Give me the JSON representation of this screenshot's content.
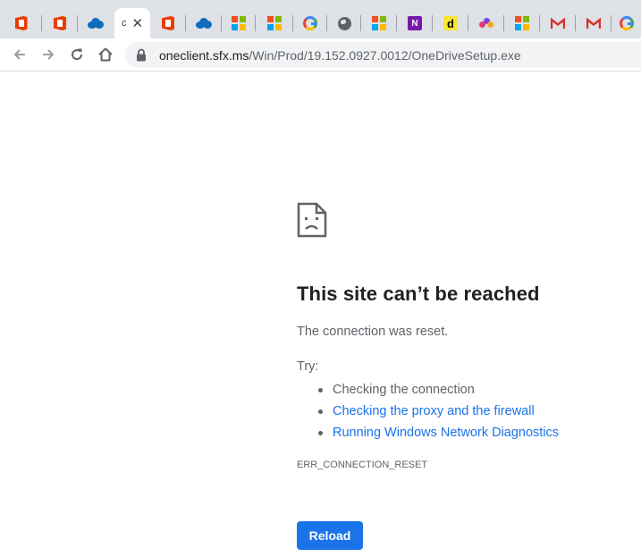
{
  "browser": {
    "tabs": [
      {
        "favicon": "office-icon",
        "title": ""
      },
      {
        "favicon": "office-icon",
        "title": ""
      },
      {
        "favicon": "onedrive-cloud-icon",
        "title": ""
      },
      {
        "favicon": "",
        "title": "c",
        "active": true,
        "close": "✕"
      },
      {
        "favicon": "office-icon",
        "title": ""
      },
      {
        "favicon": "onedrive-cloud-icon",
        "title": ""
      },
      {
        "favicon": "microsoft-icon",
        "title": ""
      },
      {
        "favicon": "microsoft-icon",
        "title": ""
      },
      {
        "favicon": "google-icon",
        "title": ""
      },
      {
        "favicon": "globe-icon",
        "title": ""
      },
      {
        "favicon": "microsoft-icon",
        "title": ""
      },
      {
        "favicon": "onenote-icon",
        "title": ""
      },
      {
        "favicon": "d-icon",
        "title": ""
      },
      {
        "favicon": "dots-icon",
        "title": ""
      },
      {
        "favicon": "microsoft-icon",
        "title": ""
      },
      {
        "favicon": "gmail-icon",
        "title": ""
      },
      {
        "favicon": "gmail-icon",
        "title": ""
      },
      {
        "favicon": "google-icon",
        "title": ""
      }
    ],
    "active_tab": {
      "title": "c",
      "close": "✕"
    },
    "onenote_letter": "N",
    "d_letter": "d",
    "address": {
      "host": "oneclient.sfx.ms",
      "path": "/Win/Prod/19.152.0927.0012/OneDriveSetup.exe"
    }
  },
  "error_page": {
    "title": "This site can’t be reached",
    "description": "The connection was reset.",
    "try_label": "Try:",
    "suggestions": [
      {
        "text": "Checking the connection",
        "link": false
      },
      {
        "text": "Checking the proxy and the firewall",
        "link": true
      },
      {
        "text": "Running Windows Network Diagnostics",
        "link": true
      }
    ],
    "error_code": "ERR_CONNECTION_RESET",
    "reload_label": "Reload"
  },
  "colors": {
    "tabstrip": "#dee1e6",
    "link": "#1a73e8",
    "button": "#1a73e8",
    "text_primary": "#202124",
    "text_secondary": "#5f6368"
  }
}
